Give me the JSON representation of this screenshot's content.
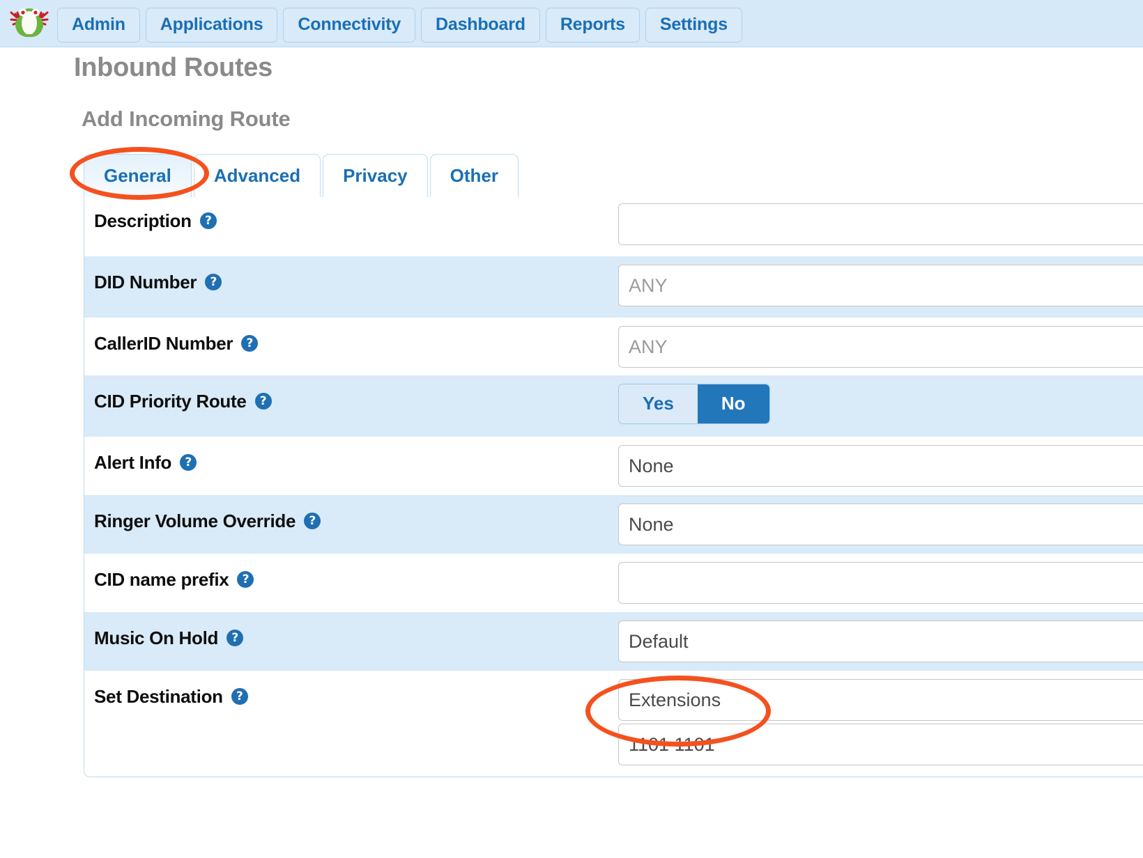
{
  "brand": {
    "logo_name": "freepbx-frog-logo"
  },
  "navbar": {
    "items": [
      {
        "label": "Admin",
        "name": "nav-admin"
      },
      {
        "label": "Applications",
        "name": "nav-applications"
      },
      {
        "label": "Connectivity",
        "name": "nav-connectivity"
      },
      {
        "label": "Dashboard",
        "name": "nav-dashboard"
      },
      {
        "label": "Reports",
        "name": "nav-reports"
      },
      {
        "label": "Settings",
        "name": "nav-settings"
      }
    ]
  },
  "page": {
    "title": "Inbound Routes",
    "section_title": "Add Incoming Route"
  },
  "tabs": [
    {
      "label": "General",
      "active": true
    },
    {
      "label": "Advanced",
      "active": false
    },
    {
      "label": "Privacy",
      "active": false
    },
    {
      "label": "Other",
      "active": false
    }
  ],
  "form": {
    "help_glyph": "?",
    "rows": [
      {
        "label": "Description",
        "value": "",
        "kind": "text",
        "shaded": false
      },
      {
        "label": "DID Number",
        "value": "ANY",
        "kind": "text",
        "shaded": true,
        "is_placeholder": true
      },
      {
        "label": "CallerID Number",
        "value": "ANY",
        "kind": "text",
        "shaded": false,
        "is_placeholder": true
      },
      {
        "label": "CID Priority Route",
        "value": "No",
        "kind": "toggle",
        "shaded": true
      },
      {
        "label": "Alert Info",
        "value": "None",
        "kind": "select",
        "shaded": false
      },
      {
        "label": "Ringer Volume Override",
        "value": "None",
        "kind": "select",
        "shaded": true
      },
      {
        "label": "CID name prefix",
        "value": "",
        "kind": "text",
        "shaded": false
      },
      {
        "label": "Music On Hold",
        "value": "Default",
        "kind": "select",
        "shaded": true
      },
      {
        "label": "Set Destination",
        "value": "Extensions",
        "value2": "1101 1101",
        "kind": "select2",
        "shaded": false
      }
    ],
    "toggle": {
      "yes_label": "Yes",
      "no_label": "No",
      "selected": "No"
    }
  },
  "annotations": [
    {
      "name": "annotation-circle-general-tab",
      "target": "General tab",
      "color": "#f4511e"
    },
    {
      "name": "annotation-circle-set-destination",
      "target": "Set Destination values",
      "color": "#f4511e"
    }
  ]
}
